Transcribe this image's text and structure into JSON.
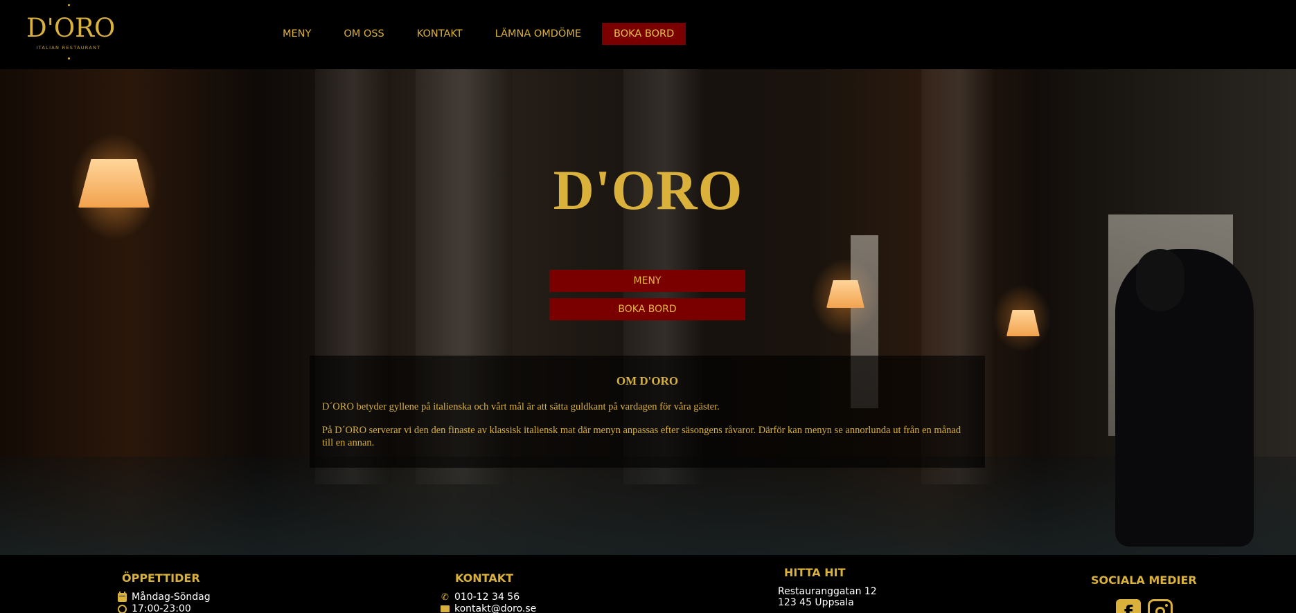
{
  "brand": {
    "logo_text": "D'ORO",
    "logo_subtitle": "ITALIAN RESTAURANT",
    "accent_color": "#d9b13b",
    "button_color": "#7a0000"
  },
  "nav": {
    "items": [
      {
        "label": "MENY"
      },
      {
        "label": "OM OSS"
      },
      {
        "label": "KONTAKT"
      },
      {
        "label": "LÄMNA OMDÖME"
      }
    ],
    "book_label": "BOKA BORD"
  },
  "hero": {
    "title": "D'ORO",
    "menu_button": "MENY",
    "book_button": "BOKA BORD"
  },
  "about": {
    "title": "OM D'ORO",
    "paragraphs": [
      "D´ORO betyder gyllene på italienska och vårt mål är att sätta guldkant på vardagen för våra gäster.",
      "På D´ORO serverar vi den den finaste av klassisk italiensk mat där menyn anpassas efter säsongens råvaror. Därför kan menyn se annorlunda ut från en månad till en annan."
    ]
  },
  "footer": {
    "hours": {
      "title": "ÖPPETTIDER",
      "days": "Måndag-Söndag",
      "time": "17:00-23:00"
    },
    "contact": {
      "title": "KONTAKT",
      "phone": "010-12 34 56",
      "email": "kontakt@doro.se"
    },
    "directions": {
      "title": "HITTA HIT",
      "street": "Restauranggatan 12",
      "city": "123 45 Uppsala"
    },
    "social": {
      "title": "SOCIALA MEDIER",
      "icons": [
        "facebook-icon",
        "instagram-icon"
      ]
    }
  }
}
